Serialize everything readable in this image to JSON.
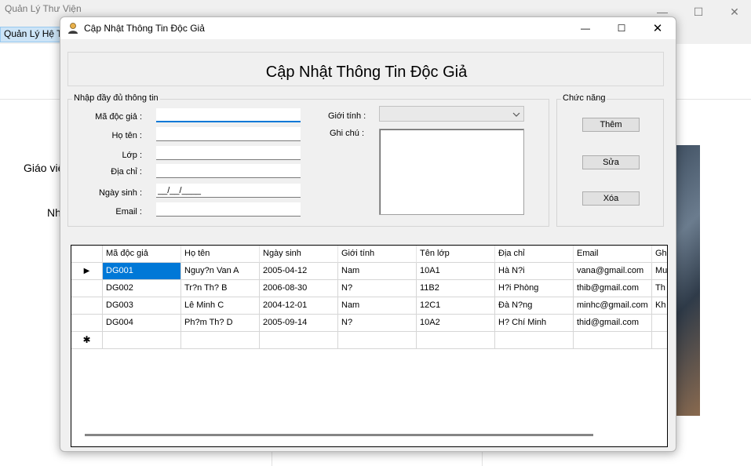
{
  "background_app": {
    "title": "Quản Lý Thư Viện",
    "menu_item": "Quản Lý Hệ T",
    "label_1": "Giáo viê",
    "label_2": "Nh",
    "controls": {
      "minimize": "—",
      "maximize": "☐",
      "close": "✕"
    }
  },
  "dialog": {
    "title": "Cập Nhật Thông Tin Độc Giả",
    "controls": {
      "minimize": "—",
      "maximize": "☐",
      "close": "✕"
    },
    "header_title": "Cập Nhật Thông Tin Độc Giả",
    "input_group": {
      "label": "Nhập đầy đủ thông tin",
      "fields": {
        "ma_doc_gia": {
          "label": "Mã độc giả :",
          "value": ""
        },
        "ho_ten": {
          "label": "Họ tên :",
          "value": ""
        },
        "lop": {
          "label": "Lớp :",
          "value": ""
        },
        "dia_chi": {
          "label": "Địa chỉ :",
          "value": ""
        },
        "ngay_sinh": {
          "label": "Ngày sinh :",
          "value": "__/__/____"
        },
        "email": {
          "label": "Email :",
          "value": ""
        },
        "gioi_tinh": {
          "label": "Giới tính :",
          "value": ""
        },
        "ghi_chu": {
          "label": "Ghi chú :",
          "value": ""
        }
      }
    },
    "function_group": {
      "label": "Chức năng",
      "add": "Thêm",
      "edit": "Sửa",
      "delete": "Xóa"
    },
    "grid": {
      "columns": [
        "Mã độc giả",
        "Họ tên",
        "Ngày sinh",
        "Giới tính",
        "Tên lớp",
        "Địa chỉ",
        "Email",
        "Gh"
      ],
      "rows": [
        [
          "DG001",
          "Nguy?n Van A",
          "2005-04-12",
          "Nam",
          "10A1",
          "Hà N?i",
          "vana@gmail.com",
          "Mu"
        ],
        [
          "DG002",
          "Tr?n Th? B",
          "2006-08-30",
          "N?",
          "11B2",
          "H?i Phòng",
          "thib@gmail.com",
          "Th"
        ],
        [
          "DG003",
          "Lê Minh C",
          "2004-12-01",
          "Nam",
          "12C1",
          "Ðà N?ng",
          "minhc@gmail.com",
          "Kh"
        ],
        [
          "DG004",
          "Ph?m Th? D",
          "2005-09-14",
          "N?",
          "10A2",
          "H? Chí Minh",
          "thid@gmail.com",
          ""
        ]
      ],
      "current_row_marker": "▶",
      "new_row_marker": "✱"
    }
  },
  "icons": {
    "dialog_icon": "user-icon",
    "dropdown": "chevron-down-icon"
  },
  "colors": {
    "selection": "#0078d7",
    "menu_highlight": "#cce4f7"
  }
}
